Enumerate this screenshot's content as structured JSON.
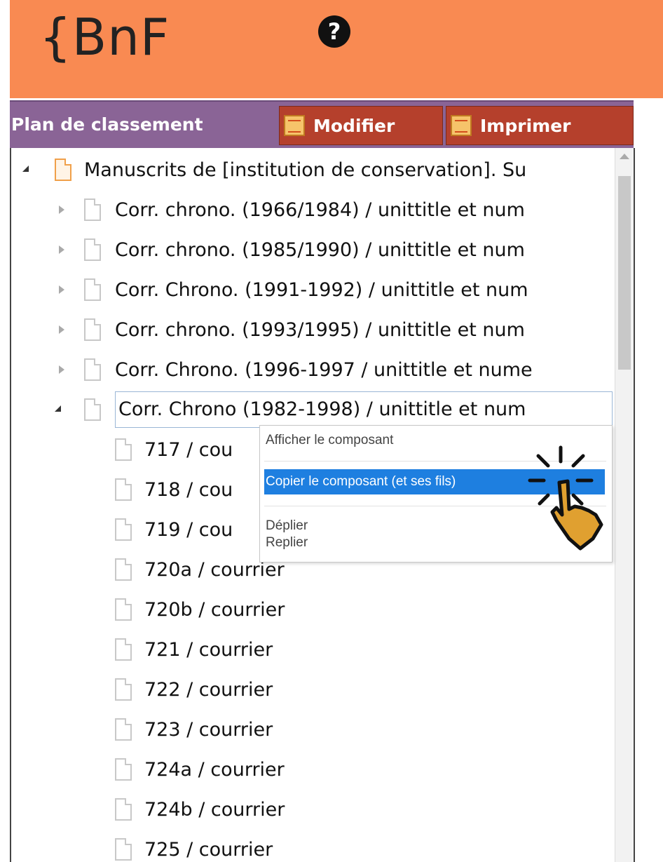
{
  "header": {
    "logo_text": "{BnF",
    "help_icon": "?",
    "background": "#f98a52"
  },
  "toolbar": {
    "title": "Plan de classement",
    "buttons": [
      {
        "label": "Modifier",
        "icon": "edit-icon"
      },
      {
        "label": "Imprimer",
        "icon": "print-icon"
      }
    ],
    "background": "#8a6496",
    "button_color": "#b5402c"
  },
  "tree": {
    "root": {
      "label": "Manuscrits de [institution de conservation]. Su",
      "expanded": true
    },
    "children": [
      {
        "label": "Corr. chrono. (1966/1984) / unittitle et num",
        "expanded": false
      },
      {
        "label": "Corr. chrono. (1985/1990) / unittitle et num",
        "expanded": false
      },
      {
        "label": "Corr. Chrono. (1991-1992) / unittitle et num",
        "expanded": false
      },
      {
        "label": "Corr. chrono. (1993/1995) / unittitle et num",
        "expanded": false
      },
      {
        "label": "Corr. Chrono. (1996-1997 / unittitle et nume",
        "expanded": false
      },
      {
        "label": "Corr. Chrono (1982-1998) / unittitle et num",
        "expanded": true,
        "selected": true
      }
    ],
    "leaves": [
      "717 / cou",
      "718 / cou",
      "719 / cou",
      "720a / courrier",
      "720b / courrier",
      "721 / courrier",
      "722 / courrier",
      "723 / courrier",
      "724a / courrier",
      "724b / courrier",
      "725 / courrier"
    ]
  },
  "context_menu": {
    "items": [
      {
        "label": "Afficher le composant"
      },
      {
        "label": "Copier le composant (et ses fils)",
        "highlighted": true
      },
      {
        "label": "Déplier"
      },
      {
        "label": "Replier"
      }
    ],
    "highlight_color": "#1e7fe0"
  },
  "cursor": {
    "icon": "hand-pointer-click-icon",
    "color": "#e0a030"
  }
}
